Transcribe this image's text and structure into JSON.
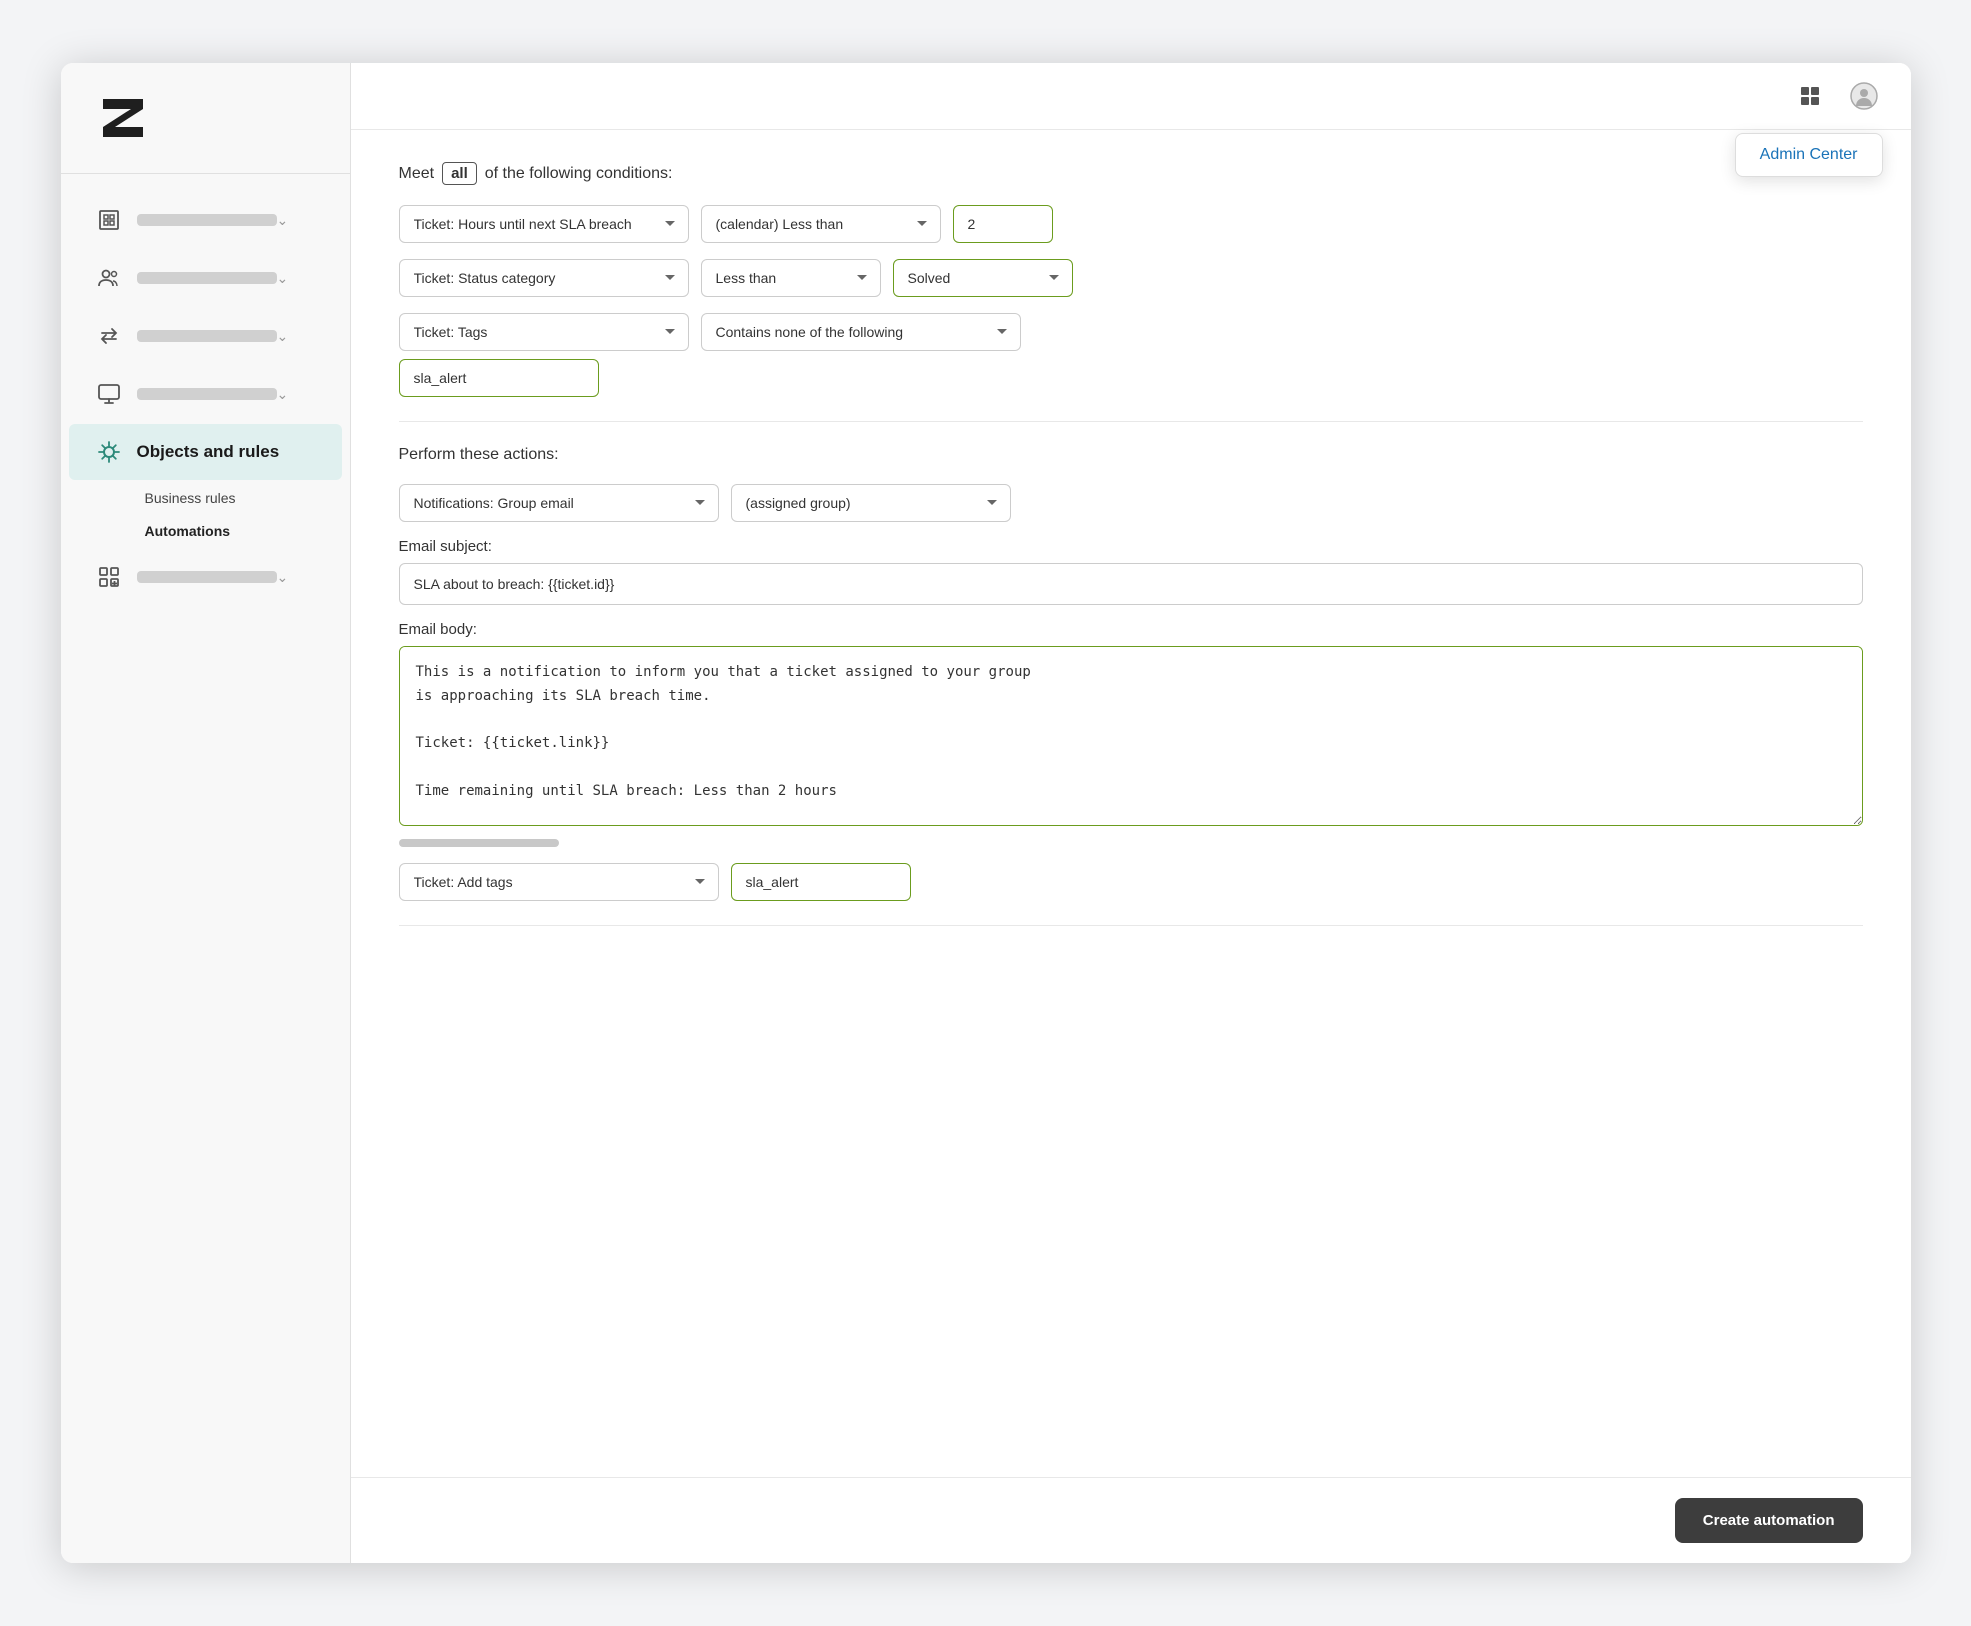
{
  "app": {
    "title": "Zendesk Admin"
  },
  "header": {
    "admin_center_label": "Admin Center"
  },
  "sidebar": {
    "nav_items": [
      {
        "id": "building",
        "label_placeholder": true,
        "has_chevron": true
      },
      {
        "id": "people",
        "label_placeholder": true,
        "has_chevron": true
      },
      {
        "id": "arrows",
        "label_placeholder": true,
        "has_chevron": true
      },
      {
        "id": "monitor",
        "label_placeholder": true,
        "has_chevron": true
      },
      {
        "id": "objects",
        "label": "Objects and rules",
        "active": true,
        "has_chevron": false
      },
      {
        "id": "grid",
        "label_placeholder": true,
        "has_chevron": true
      }
    ],
    "sub_items": [
      {
        "label": "Business rules",
        "active": false
      },
      {
        "label": "Automations",
        "active": true
      }
    ]
  },
  "conditions": {
    "meet_label": "Meet",
    "all_badge": "all",
    "of_label": "of the following conditions:",
    "rows": [
      {
        "field": "Ticket: Hours until next SLA breach",
        "operator": "(calendar) Less than",
        "value_input": "2"
      },
      {
        "field": "Ticket: Status category",
        "operator": "Less than",
        "value_select": "Solved"
      },
      {
        "field": "Ticket: Tags",
        "operator": "Contains none of the following",
        "tag_value": "sla_alert"
      }
    ]
  },
  "actions": {
    "label": "Perform these actions:",
    "rows": [
      {
        "action": "Notifications: Group email",
        "value": "(assigned group)"
      }
    ],
    "email_subject_label": "Email subject:",
    "email_subject_value": "SLA about to breach: {{ticket.id}}",
    "email_body_label": "Email body:",
    "email_body_value": "This is a notification to inform you that a ticket assigned to your group\nis approaching its SLA breach time.\n\nTicket: {{ticket.link}}\n\nTime remaining until SLA breach: Less than 2 hours\n\nPrioritize this ticket to ensure it is resolved or addressed promptly.",
    "add_tags_action": "Ticket: Add tags",
    "add_tags_value": "sla_alert"
  },
  "footer": {
    "create_button_label": "Create automation"
  }
}
